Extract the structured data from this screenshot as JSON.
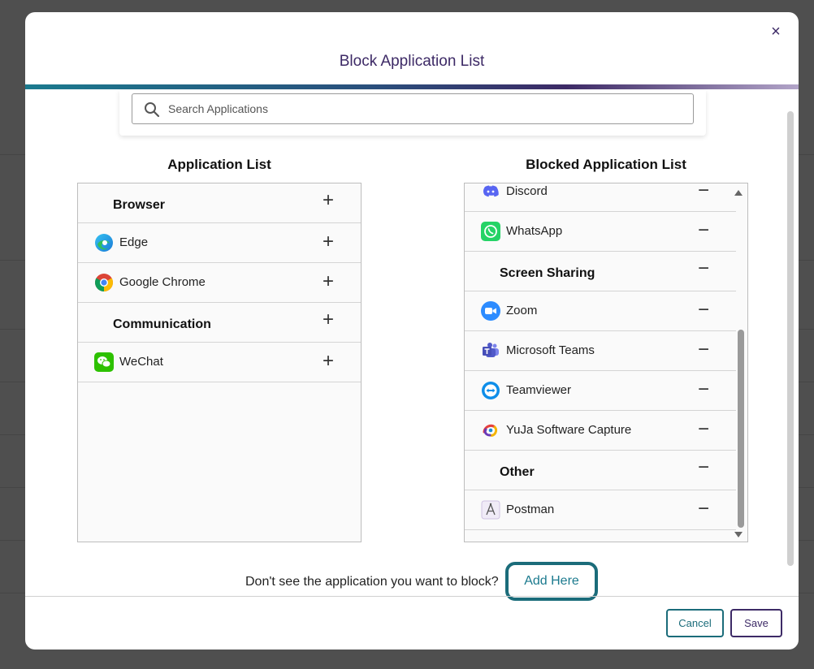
{
  "modal": {
    "title": "Block Application List",
    "close_label": "×"
  },
  "search": {
    "placeholder": "Search Applications",
    "value": ""
  },
  "application_list": {
    "heading": "Application List",
    "action_symbol": "+",
    "items": [
      {
        "type": "category",
        "label": "Browser"
      },
      {
        "type": "app",
        "label": "Edge",
        "icon": "edge-icon"
      },
      {
        "type": "app",
        "label": "Google Chrome",
        "icon": "chrome-icon"
      },
      {
        "type": "category",
        "label": "Communication"
      },
      {
        "type": "app",
        "label": "WeChat",
        "icon": "wechat-icon"
      }
    ]
  },
  "blocked_list": {
    "heading": "Blocked Application List",
    "action_symbol": "−",
    "items": [
      {
        "type": "app",
        "label": "Discord",
        "icon": "discord-icon"
      },
      {
        "type": "app",
        "label": "WhatsApp",
        "icon": "whatsapp-icon"
      },
      {
        "type": "category",
        "label": "Screen Sharing"
      },
      {
        "type": "app",
        "label": "Zoom",
        "icon": "zoom-icon"
      },
      {
        "type": "app",
        "label": "Microsoft Teams",
        "icon": "teams-icon"
      },
      {
        "type": "app",
        "label": "Teamviewer",
        "icon": "teamviewer-icon"
      },
      {
        "type": "app",
        "label": "YuJa Software Capture",
        "icon": "yuja-icon"
      },
      {
        "type": "category",
        "label": "Other"
      },
      {
        "type": "app",
        "label": "Postman",
        "icon": "postman-icon"
      }
    ]
  },
  "footer": {
    "prompt": "Don't see the application you want to block?",
    "add_here_label": "Add Here",
    "cancel_label": "Cancel",
    "save_label": "Save"
  },
  "colors": {
    "accent_teal": "#1b6c7a",
    "accent_purple": "#3d2a66"
  }
}
